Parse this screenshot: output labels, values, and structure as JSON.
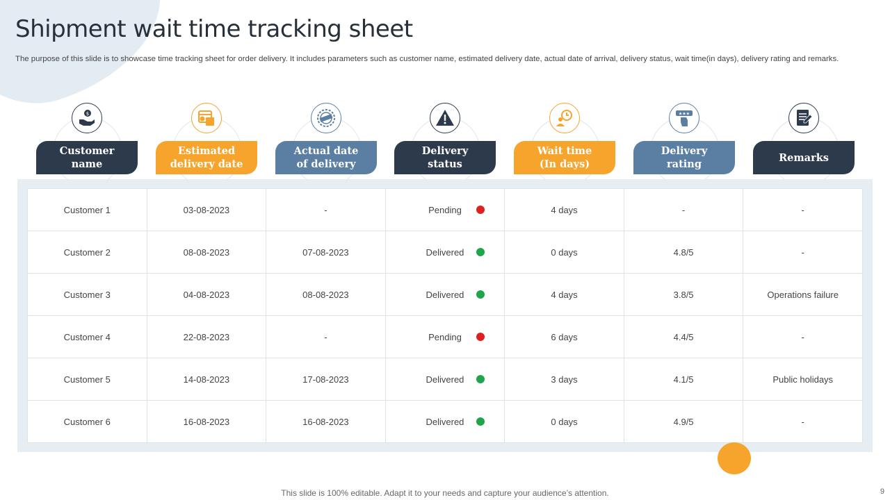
{
  "slide": {
    "title": "Shipment wait time tracking sheet",
    "description": "The purpose of this slide is to showcase time tracking sheet for order delivery. It includes parameters such as customer name, estimated delivery date, actual date of arrival,  delivery status, wait time(in days), delivery rating and remarks.",
    "footer": "This slide is 100% editable. Adapt it to your needs and capture your audience’s attention.",
    "page_number": "9"
  },
  "colors": {
    "navy": "#2c3a4c",
    "orange": "#f7a42c",
    "steel": "#5b7ea3",
    "pending": "#e02020",
    "delivered": "#1fa64a"
  },
  "columns": [
    {
      "line1": "Customer",
      "line2": "name",
      "icon": "hand-coin-icon",
      "color": "navy"
    },
    {
      "line1": "Estimated",
      "line2": "delivery date",
      "icon": "calendar-calculator-icon",
      "color": "orange"
    },
    {
      "line1": "Actual date",
      "line2": "of delivery",
      "icon": "delivery-stamp-icon",
      "color": "steel"
    },
    {
      "line1": "Delivery",
      "line2": "status",
      "icon": "warning-icon",
      "color": "navy"
    },
    {
      "line1": "Wait time",
      "line2": "(In days)",
      "icon": "clock-person-icon",
      "color": "orange"
    },
    {
      "line1": "Delivery",
      "line2": "rating",
      "icon": "rating-stars-icon",
      "color": "steel"
    },
    {
      "line1": "Remarks",
      "line2": "",
      "icon": "notes-icon",
      "color": "navy"
    }
  ],
  "rows": [
    {
      "customer": "Customer 1",
      "estimated": "03-08-2023",
      "actual": "-",
      "status": "Pending",
      "status_color": "pending",
      "wait": "4 days",
      "rating": "-",
      "remarks": "-"
    },
    {
      "customer": "Customer 2",
      "estimated": "08-08-2023",
      "actual": "07-08-2023",
      "status": "Delivered",
      "status_color": "delivered",
      "wait": "0 days",
      "rating": "4.8/5",
      "remarks": "-"
    },
    {
      "customer": "Customer 3",
      "estimated": "04-08-2023",
      "actual": "08-08-2023",
      "status": "Delivered",
      "status_color": "delivered",
      "wait": "4 days",
      "rating": "3.8/5",
      "remarks": "Operations failure"
    },
    {
      "customer": "Customer 4",
      "estimated": "22-08-2023",
      "actual": "-",
      "status": "Pending",
      "status_color": "pending",
      "wait": "6 days",
      "rating": "4.4/5",
      "remarks": "-"
    },
    {
      "customer": "Customer 5",
      "estimated": "14-08-2023",
      "actual": "17-08-2023",
      "status": "Delivered",
      "status_color": "delivered",
      "wait": "3 days",
      "rating": "4.1/5",
      "remarks": "Public holidays"
    },
    {
      "customer": "Customer 6",
      "estimated": "16-08-2023",
      "actual": "16-08-2023",
      "status": "Delivered",
      "status_color": "delivered",
      "wait": "0 days",
      "rating": "4.9/5",
      "remarks": "-"
    }
  ]
}
